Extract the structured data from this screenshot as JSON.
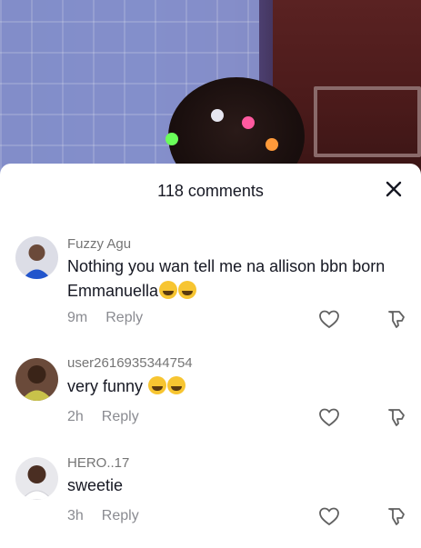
{
  "sheet": {
    "count_label": "118 comments"
  },
  "comments": [
    {
      "username": "Fuzzy Agu",
      "text": "Nothing you wan tell me na allison bbn born Emmanuella",
      "emojis": [
        "face-with-tears-of-joy",
        "face-with-tears-of-joy"
      ],
      "time": "9m",
      "reply_label": "Reply",
      "avatar_color": "#2255cc"
    },
    {
      "username": "user2616935344754",
      "text": "very funny",
      "emojis": [
        "rolling-on-floor-laughing",
        "grinning-squinting-face"
      ],
      "time": "2h",
      "reply_label": "Reply",
      "avatar_color": "#c8c24a"
    },
    {
      "username": "HERO..17",
      "text": "sweetie",
      "emojis": [],
      "time": "3h",
      "reply_label": "Reply",
      "avatar_color": "#e8e8ec"
    }
  ]
}
